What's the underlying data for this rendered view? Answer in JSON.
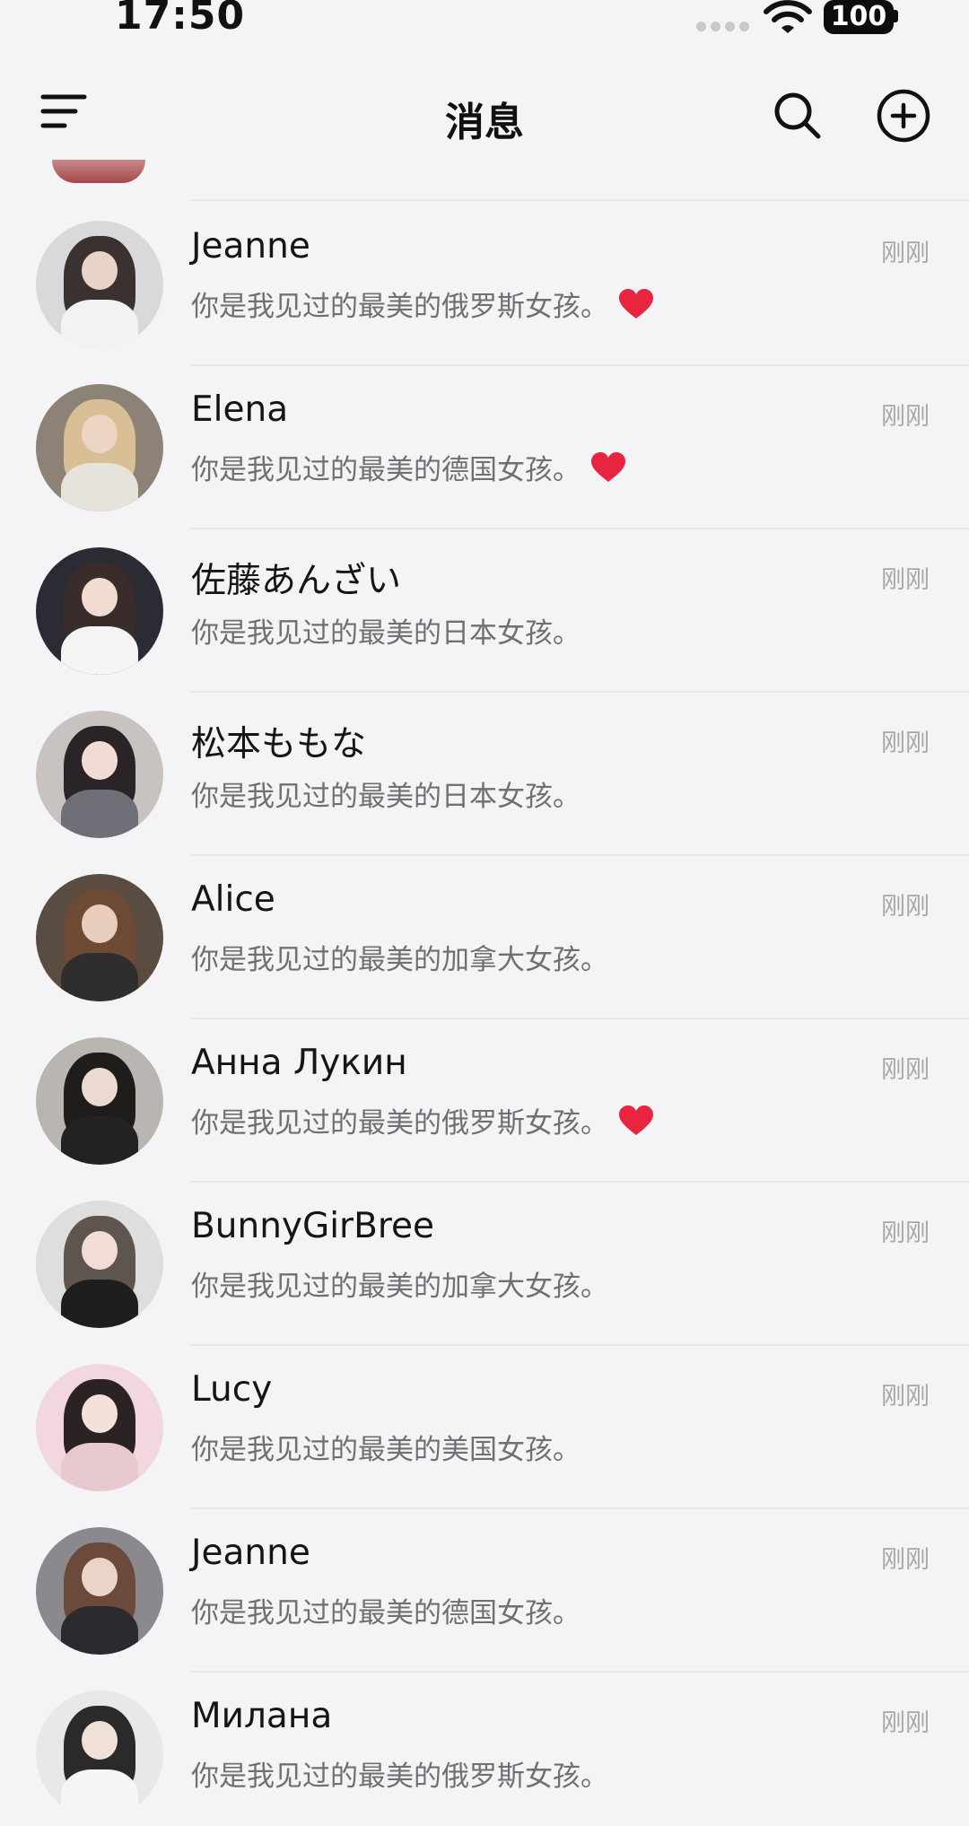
{
  "status_bar": {
    "time": "17:50",
    "battery": "100"
  },
  "header": {
    "title": "消息"
  },
  "icons": {
    "menu": "menu-icon",
    "search": "search-icon",
    "add": "add-circle-icon",
    "heart": "heart-icon"
  },
  "colors": {
    "heart": "#e8243f",
    "time_text": "#a7a7ab",
    "message_text": "#707074"
  },
  "conversations": [
    {
      "name": "Jeanne",
      "time": "刚刚",
      "message": "你是我见过的最美的俄罗斯女孩。",
      "heart": true
    },
    {
      "name": "Elena",
      "time": "刚刚",
      "message": "你是我见过的最美的德国女孩。",
      "heart": true
    },
    {
      "name": "佐藤あんざい",
      "time": "刚刚",
      "message": "你是我见过的最美的日本女孩。",
      "heart": false
    },
    {
      "name": "松本ももな",
      "time": "刚刚",
      "message": "你是我见过的最美的日本女孩。",
      "heart": false
    },
    {
      "name": "Alice",
      "time": "刚刚",
      "message": "你是我见过的最美的加拿大女孩。",
      "heart": false
    },
    {
      "name": "Анна Лукин",
      "time": "刚刚",
      "message": "你是我见过的最美的俄罗斯女孩。",
      "heart": true
    },
    {
      "name": "BunnyGirBree",
      "time": "刚刚",
      "message": "你是我见过的最美的加拿大女孩。",
      "heart": false
    },
    {
      "name": "Lucy",
      "time": "刚刚",
      "message": "你是我见过的最美的美国女孩。",
      "heart": false
    },
    {
      "name": "Jeanne",
      "time": "刚刚",
      "message": "你是我见过的最美的德国女孩。",
      "heart": false
    },
    {
      "name": "Милана",
      "time": "刚刚",
      "message": "你是我见过的最美的俄罗斯女孩。",
      "heart": false
    }
  ]
}
